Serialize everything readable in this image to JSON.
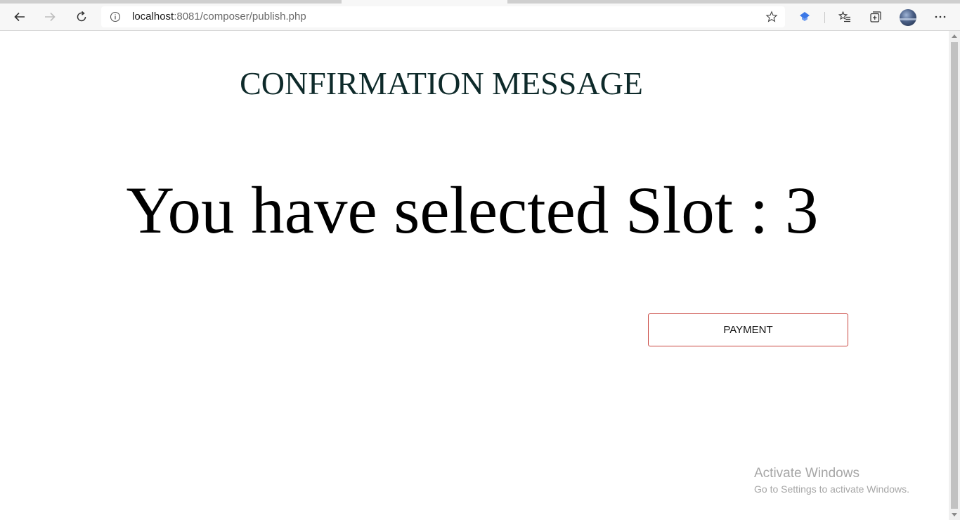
{
  "browser": {
    "address": {
      "host": "localhost",
      "path": ":8081/composer/publish.php"
    },
    "icons": {
      "back": "back-arrow-icon",
      "forward": "forward-arrow-icon",
      "refresh": "refresh-icon",
      "info": "info-icon",
      "favorite": "star-icon",
      "extension": "extension-icon",
      "favorites": "favorites-icon",
      "collections": "collections-icon",
      "profile": "avatar",
      "menu": "more-icon"
    }
  },
  "page": {
    "title": "CONFIRMATION MESSAGE",
    "message": "You have selected Slot : 3",
    "payment_label": "PAYMENT",
    "accent_color": "#c9453f"
  },
  "watermark": {
    "title": "Activate Windows",
    "subtitle": "Go to Settings to activate Windows."
  }
}
